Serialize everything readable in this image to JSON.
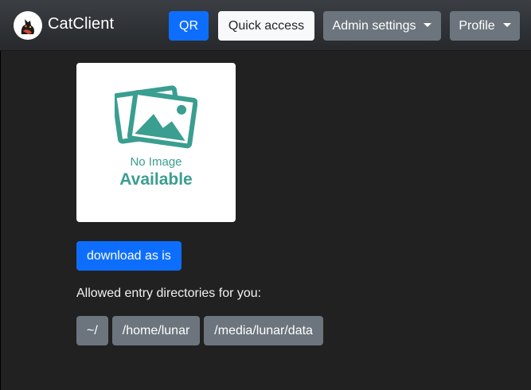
{
  "navbar": {
    "brand": "CatClient",
    "qr_label": "QR",
    "quick_access_label": "Quick access",
    "admin_settings_label": "Admin settings",
    "profile_label": "Profile"
  },
  "preview": {
    "line1": "No Image",
    "line2": "Available"
  },
  "download_label": "download as is",
  "allowed_label": "Allowed entry directories for you:",
  "directories": [
    "~/",
    "/home/lunar",
    "/media/lunar/data"
  ],
  "colors": {
    "primary": "#0d6efd",
    "secondary": "#6c757d",
    "placeholder": "#3a9e90"
  }
}
